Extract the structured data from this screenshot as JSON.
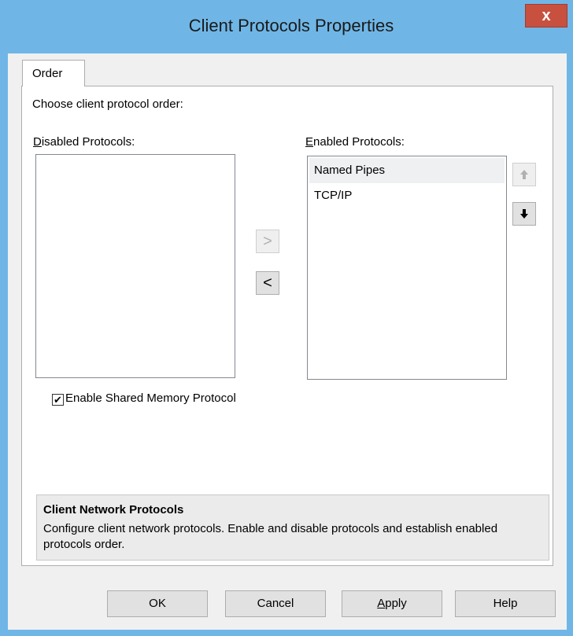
{
  "window": {
    "title": "Client Protocols Properties",
    "close_label": "x"
  },
  "tabs": [
    {
      "label": "Order"
    }
  ],
  "order": {
    "prompt": "Choose client protocol order:",
    "disabled_label_hotkey": "D",
    "disabled_label_rest": "isabled Protocols:",
    "enabled_label_hotkey": "E",
    "enabled_label_rest": "nabled Protocols:",
    "disabled_items": [],
    "enabled_items": [
      {
        "label": "Named Pipes",
        "selected": true
      },
      {
        "label": "TCP/IP",
        "selected": false
      }
    ],
    "move_right_glyph": ">",
    "move_left_glyph": "<",
    "move_up_icon": "up-arrow-icon",
    "move_down_icon": "down-arrow-icon",
    "shared_memory": {
      "label": "Enable Shared Memory Protocol",
      "checked": true,
      "check_glyph": "✔"
    }
  },
  "info": {
    "title": "Client Network Protocols",
    "text": "Configure client network protocols. Enable and disable protocols and establish enabled protocols order."
  },
  "buttons": {
    "ok": "OK",
    "cancel": "Cancel",
    "apply_hotkey": "A",
    "apply_rest": "pply",
    "help": "Help"
  },
  "colors": {
    "frame": "#6fb6e6",
    "close": "#c7503f",
    "dialog_bg": "#f0f0f0"
  }
}
